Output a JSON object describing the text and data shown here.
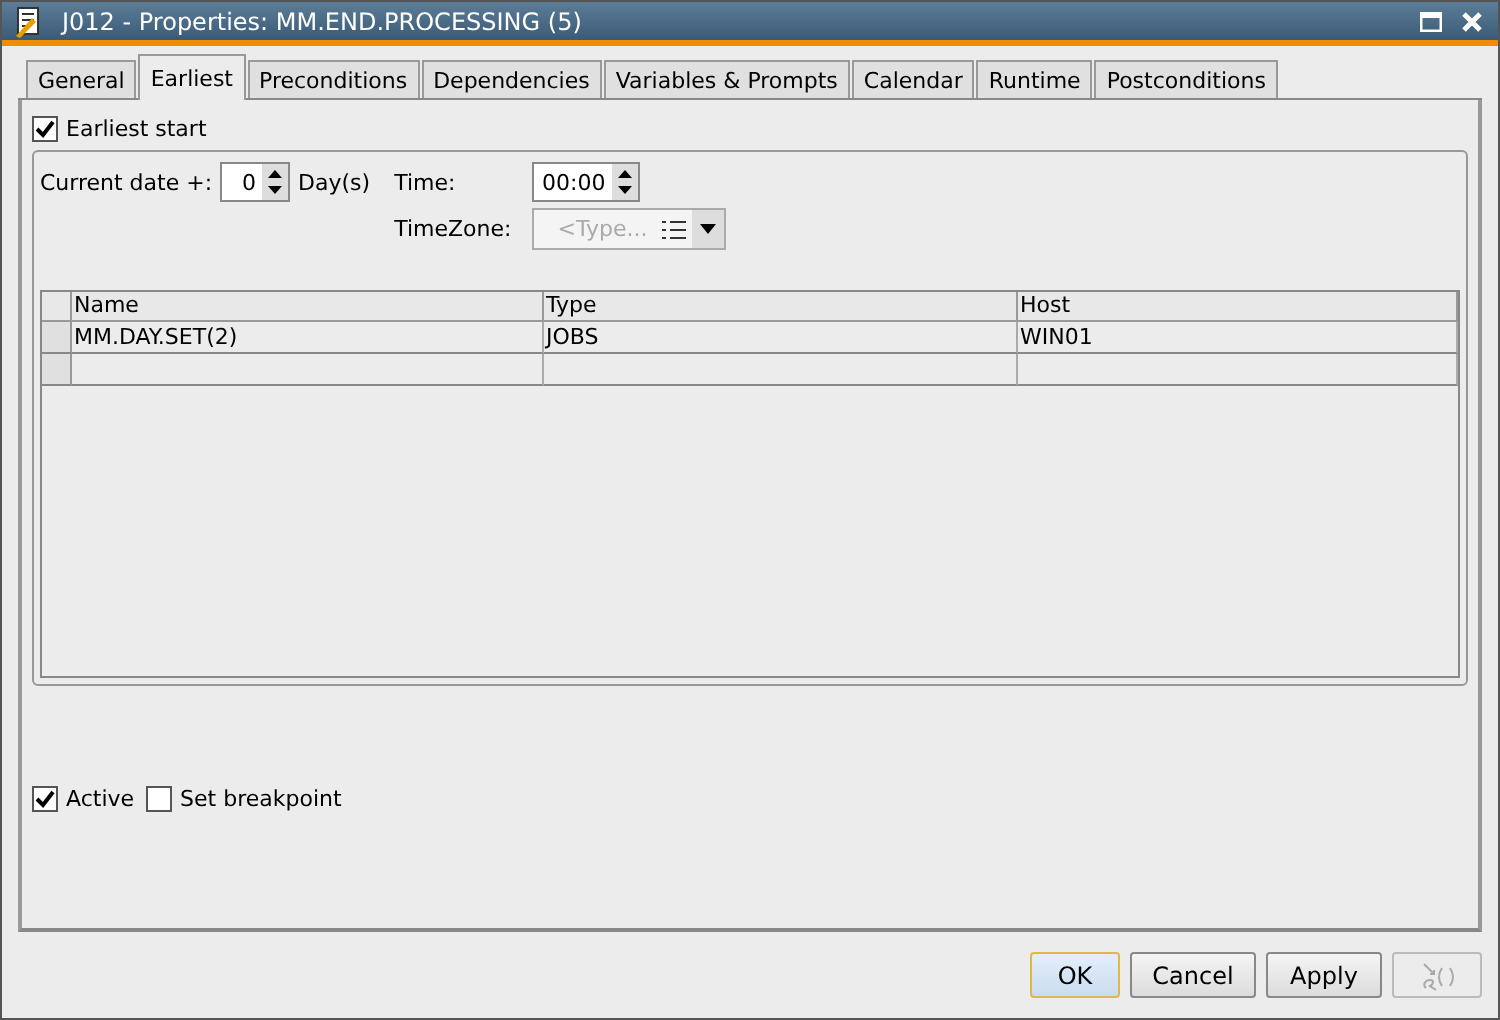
{
  "window": {
    "title": "J012 - Properties: MM.END.PROCESSING (5)"
  },
  "tabs": [
    {
      "label": "General",
      "selected": false
    },
    {
      "label": "Earliest",
      "selected": true
    },
    {
      "label": "Preconditions",
      "selected": false
    },
    {
      "label": "Dependencies",
      "selected": false
    },
    {
      "label": "Variables & Prompts",
      "selected": false
    },
    {
      "label": "Calendar",
      "selected": false
    },
    {
      "label": "Runtime",
      "selected": false
    },
    {
      "label": "Postconditions",
      "selected": false
    }
  ],
  "earliest_start": {
    "label": "Earliest start",
    "checked": true
  },
  "current_date": {
    "label": "Current date +:",
    "value": "0",
    "unit": "Day(s)"
  },
  "time": {
    "label": "Time:",
    "value": "00:00"
  },
  "timezone": {
    "label": "TimeZone:",
    "placeholder": "<Type...",
    "disabled": true
  },
  "table": {
    "columns": [
      "Name",
      "Type",
      "Host"
    ],
    "rows": [
      [
        "MM.DAY.SET(2)",
        "JOBS",
        "WIN01"
      ]
    ]
  },
  "options": [
    {
      "label": "Active",
      "checked": true
    },
    {
      "label": "Set breakpoint",
      "checked": false
    }
  ],
  "buttons": [
    {
      "kind": "text",
      "label": "OK",
      "focused": true,
      "disabled": false
    },
    {
      "kind": "text",
      "label": "Cancel",
      "focused": false,
      "disabled": false
    },
    {
      "kind": "text",
      "label": "Apply",
      "focused": false,
      "disabled": false
    },
    {
      "kind": "icon",
      "focused": false,
      "disabled": true
    }
  ]
}
